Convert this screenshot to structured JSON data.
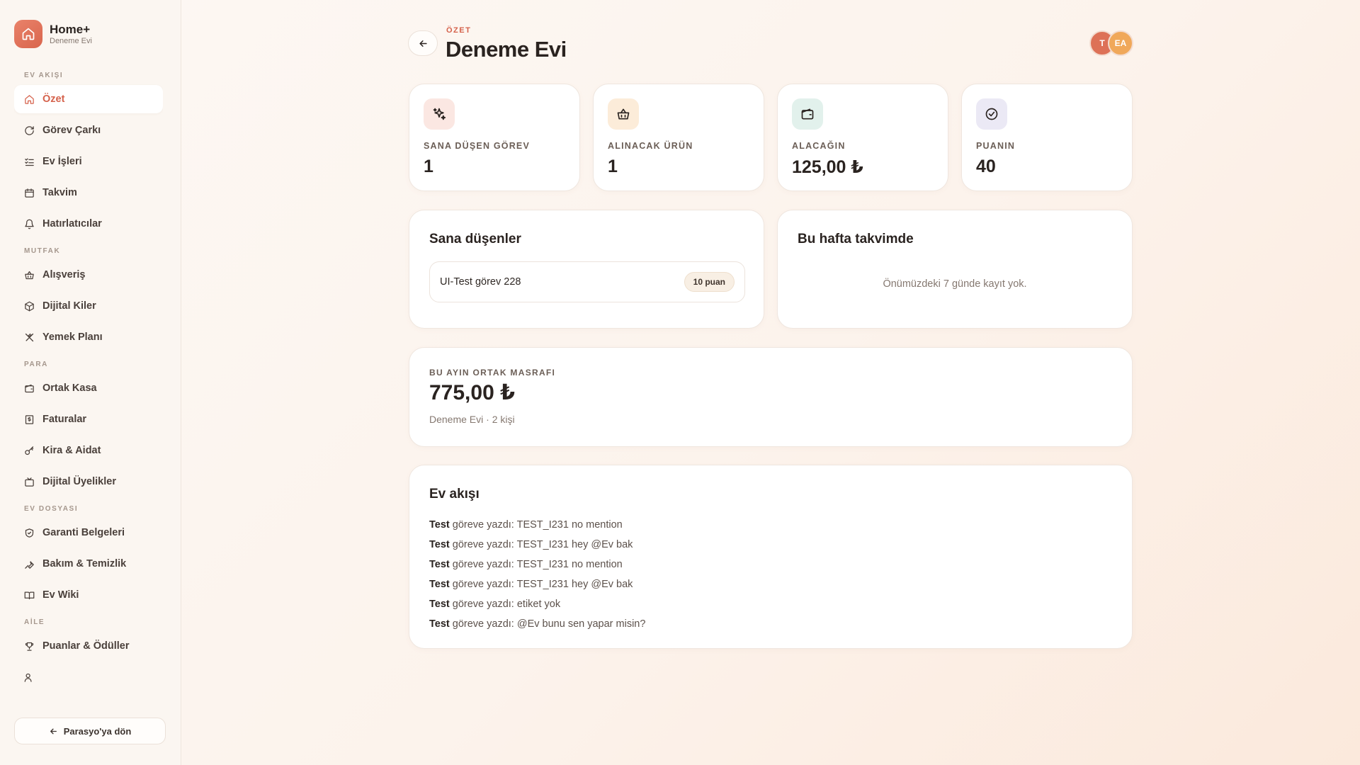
{
  "brand": {
    "name": "Home+",
    "subtitle": "Deneme Evi"
  },
  "sidebar": {
    "sections": [
      {
        "title": "EV AKIŞI",
        "items": [
          {
            "label": "Özet",
            "icon": "home-icon",
            "active": true
          },
          {
            "label": "Görev Çarkı",
            "icon": "rotate-icon"
          },
          {
            "label": "Ev İşleri",
            "icon": "list-check-icon"
          },
          {
            "label": "Takvim",
            "icon": "calendar-icon"
          },
          {
            "label": "Hatırlatıcılar",
            "icon": "bell-icon"
          }
        ]
      },
      {
        "title": "MUTFAK",
        "items": [
          {
            "label": "Alışveriş",
            "icon": "basket-icon"
          },
          {
            "label": "Dijital Kiler",
            "icon": "box-icon"
          },
          {
            "label": "Yemek Planı",
            "icon": "utensils-icon"
          }
        ]
      },
      {
        "title": "PARA",
        "items": [
          {
            "label": "Ortak Kasa",
            "icon": "wallet-icon"
          },
          {
            "label": "Faturalar",
            "icon": "receipt-icon"
          },
          {
            "label": "Kira & Aidat",
            "icon": "key-icon"
          },
          {
            "label": "Dijital Üyelikler",
            "icon": "tv-icon"
          }
        ]
      },
      {
        "title": "EV DOSYASI",
        "items": [
          {
            "label": "Garanti Belgeleri",
            "icon": "shield-icon"
          },
          {
            "label": "Bakım & Temizlik",
            "icon": "wrench-icon"
          },
          {
            "label": "Ev Wiki",
            "icon": "book-icon"
          }
        ]
      },
      {
        "title": "AİLE",
        "items": [
          {
            "label": "Puanlar & Ödüller",
            "icon": "trophy-icon"
          },
          {
            "label": "",
            "icon": "users-icon"
          }
        ]
      }
    ],
    "back_label": "Parasyo'ya dön"
  },
  "header": {
    "eyebrow": "ÖZET",
    "title": "Deneme Evi",
    "avatars": [
      "T",
      "EA"
    ]
  },
  "stats": [
    {
      "label": "SANA DÜŞEN GÖREV",
      "value": "1",
      "icon": "sparkles-icon",
      "icon_bg": "#fbe7e2",
      "icon_color": "#d5624c"
    },
    {
      "label": "ALINACAK ÜRÜN",
      "value": "1",
      "icon": "basket-icon",
      "icon_bg": "#fcecd9",
      "icon_color": "#c9782b"
    },
    {
      "label": "ALACAĞIN",
      "value": "125,00 ₺",
      "icon": "wallet-icon",
      "icon_bg": "#e2f1ec",
      "icon_color": "#2f5d52"
    },
    {
      "label": "PUANIN",
      "value": "40",
      "icon": "check-circle-icon",
      "icon_bg": "#ebe9f5",
      "icon_color": "#3b3550"
    }
  ],
  "tasks_card": {
    "title": "Sana düşenler",
    "task": "UI-Test görev 228",
    "points": "10 puan"
  },
  "calendar_card": {
    "title": "Bu hafta takvimde",
    "empty": "Önümüzdeki 7 günde kayıt yok."
  },
  "expense_card": {
    "label": "BU AYIN ORTAK MASRAFI",
    "value": "775,00 ₺",
    "sub": "Deneme Evi · 2 kişi"
  },
  "feed_card": {
    "title": "Ev akışı",
    "items": [
      {
        "user": "Test",
        "text": "göreve yazdı: TEST_I231 no mention"
      },
      {
        "user": "Test",
        "text": "göreve yazdı: TEST_I231 hey @Ev bak"
      },
      {
        "user": "Test",
        "text": "göreve yazdı: TEST_I231 no mention"
      },
      {
        "user": "Test",
        "text": "göreve yazdı: TEST_I231 hey @Ev bak"
      },
      {
        "user": "Test",
        "text": "göreve yazdı: etiket yok"
      },
      {
        "user": "Test",
        "text": "göreve yazdı: @Ev bunu sen yapar misin?"
      }
    ]
  }
}
